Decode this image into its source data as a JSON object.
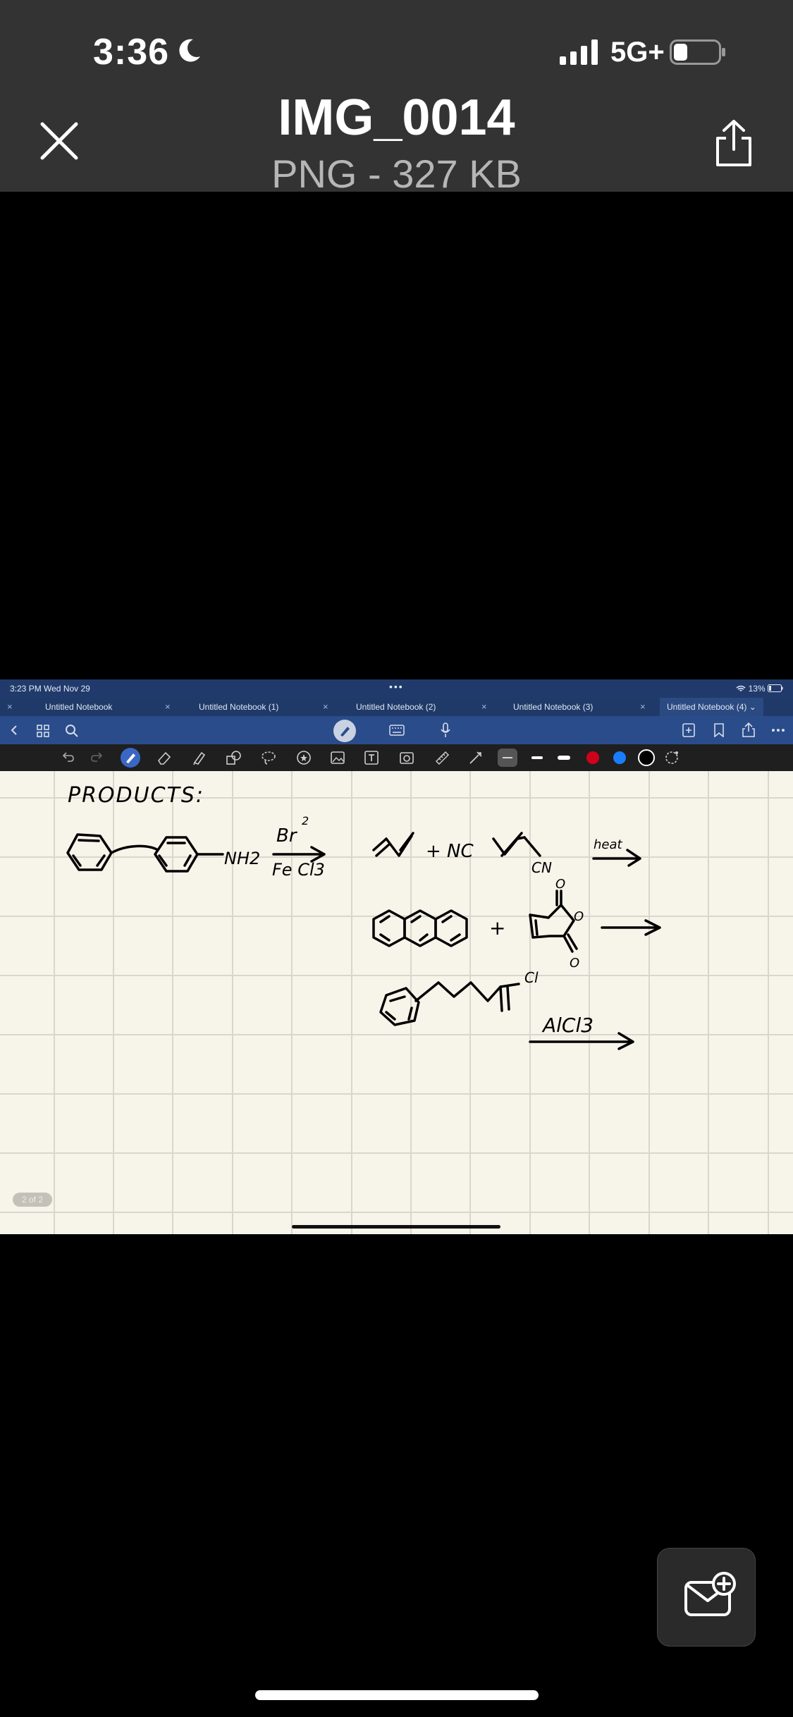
{
  "status_bar": {
    "time": "3:36",
    "network": "5G+"
  },
  "header": {
    "title": "IMG_0014",
    "subtitle": "PNG - 327 KB"
  },
  "screenshot": {
    "status": {
      "time_date": "3:23 PM   Wed Nov 29",
      "dots": "•••",
      "battery": "13%"
    },
    "tabs": [
      {
        "label": "Untitled Notebook"
      },
      {
        "label": "Untitled Notebook (1)"
      },
      {
        "label": "Untitled Notebook (2)"
      },
      {
        "label": "Untitled Notebook (3)"
      },
      {
        "label": "Untitled Notebook (4) ⌄"
      }
    ],
    "tab_close": "×",
    "note": {
      "heading": "PRODUCTS:",
      "reagent1_top": "Br",
      "reagent1_sup": "2",
      "reagent1_bottom": "Fe Cl3",
      "amine": "NH2",
      "nc": "+ NC",
      "cn": "CN",
      "heat": "heat",
      "plus2": "+",
      "alcl3": "AlCl3",
      "cl": "Cl",
      "o1": "O",
      "o2": "O",
      "o3": "O"
    },
    "page_indicator": "2 of 2",
    "colors": {
      "red": "#d0021b",
      "blue": "#1a7cff",
      "black": "#000000"
    }
  },
  "icons": [
    "moon-icon",
    "signal-icon",
    "battery-icon",
    "close-icon",
    "share-icon",
    "compose-mail-icon"
  ]
}
